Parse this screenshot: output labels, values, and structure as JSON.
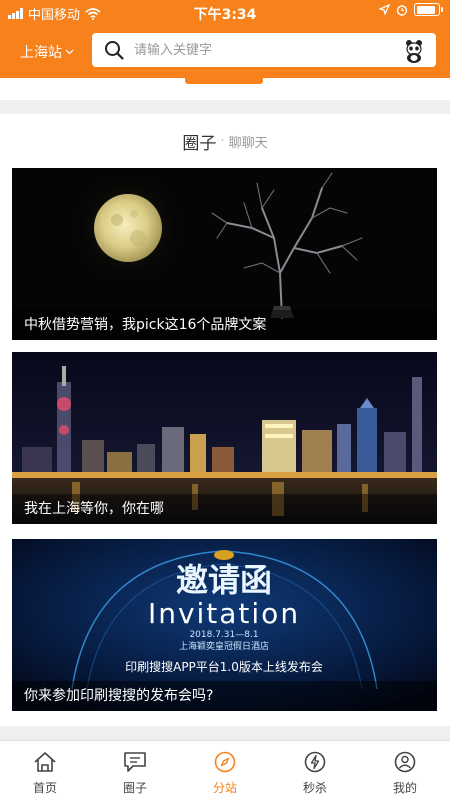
{
  "status_bar": {
    "carrier": "中国移动",
    "time": "下午3:34",
    "battery_level": 0.9
  },
  "header": {
    "city_label": "上海站",
    "search_placeholder": "请输入关键字"
  },
  "circle": {
    "title": "圈子",
    "separator": "·",
    "subtitle": "聊聊天",
    "posts": [
      {
        "caption": "中秋借势营销，我pick这16个品牌文案"
      },
      {
        "caption": "我在上海等你，你在哪"
      },
      {
        "caption": "你来参加印刷搜搜的发布会吗?",
        "invite_title": "邀请函",
        "invite_en": "Invitation",
        "invite_date": "2018.7.31—8.1",
        "invite_venue": "上海颖奕皇冠假日酒店",
        "invite_event": "印刷搜搜APP平台1.0版本上线发布会"
      }
    ]
  },
  "tabbar": {
    "active": "分站",
    "tabs": [
      {
        "label": "首页",
        "icon": "home-icon"
      },
      {
        "label": "圈子",
        "icon": "chat-icon"
      },
      {
        "label": "分站",
        "icon": "compass-icon"
      },
      {
        "label": "秒杀",
        "icon": "lightning-icon"
      },
      {
        "label": "我的",
        "icon": "user-icon"
      }
    ]
  },
  "colors": {
    "brand_orange": "#f7821b",
    "background": "#efefef"
  }
}
